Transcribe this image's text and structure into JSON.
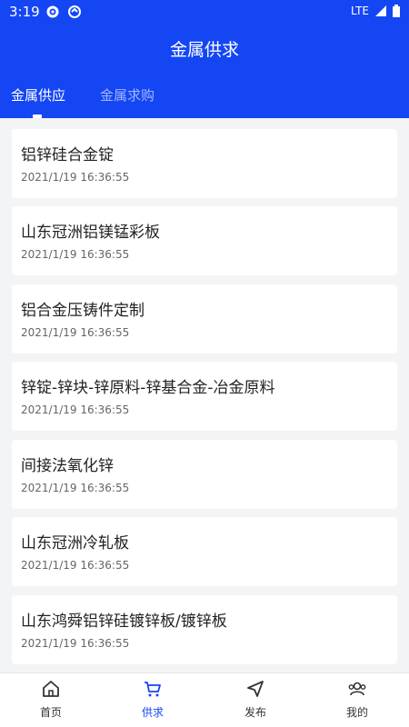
{
  "status_bar": {
    "time": "3:19",
    "network": "LTE"
  },
  "header": {
    "title": "金属供求"
  },
  "tabs": [
    {
      "label": "金属供应",
      "active": true
    },
    {
      "label": "金属求购",
      "active": false
    }
  ],
  "items": [
    {
      "name": "铝锌硅合金锭",
      "date": "2021/1/19 16:36:55"
    },
    {
      "name": "山东冠洲铝镁锰彩板",
      "date": "2021/1/19 16:36:55"
    },
    {
      "name": "铝合金压铸件定制",
      "date": "2021/1/19 16:36:55"
    },
    {
      "name": "锌锭-锌块-锌原料-锌基合金-冶金原料",
      "date": "2021/1/19 16:36:55"
    },
    {
      "name": "间接法氧化锌",
      "date": "2021/1/19 16:36:55"
    },
    {
      "name": "山东冠洲冷轧板",
      "date": "2021/1/19 16:36:55"
    },
    {
      "name": "山东鸿舜铝锌硅镀锌板/镀锌板",
      "date": "2021/1/19 16:36:55"
    }
  ],
  "bottom_nav": [
    {
      "label": "首页",
      "icon": "home-icon",
      "active": false
    },
    {
      "label": "供求",
      "icon": "cart-icon",
      "active": true
    },
    {
      "label": "发布",
      "icon": "send-icon",
      "active": false
    },
    {
      "label": "我的",
      "icon": "users-icon",
      "active": false
    }
  ],
  "colors": {
    "primary": "#1446f4",
    "background": "#f3f4f6"
  }
}
